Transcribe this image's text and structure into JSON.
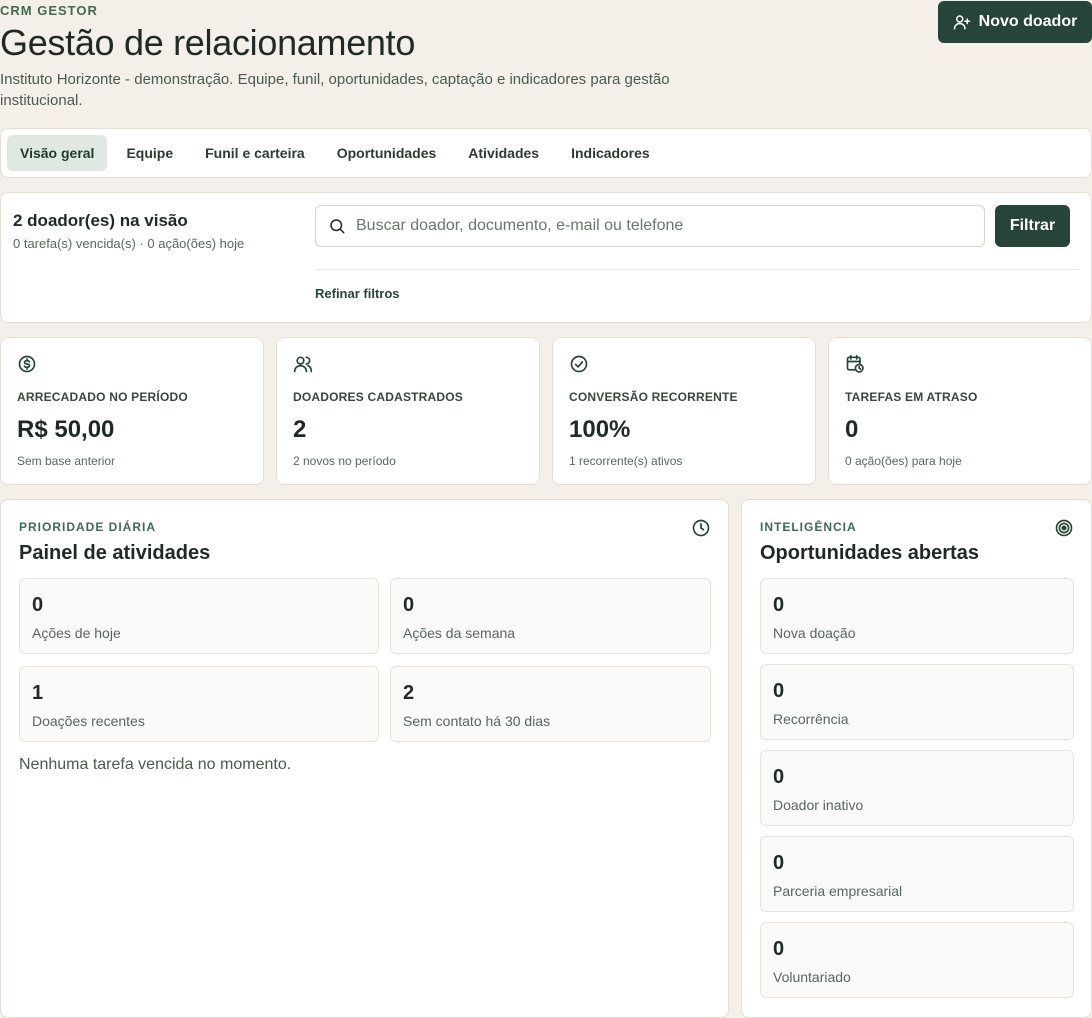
{
  "header": {
    "eyebrow": "CRM GESTOR",
    "title": "Gestão de relacionamento",
    "subtitle": "Instituto Horizonte - demonstração. Equipe, funil, oportunidades, captação e indicadores para gestão institucional.",
    "new_donor_label": "Novo doador"
  },
  "tabs": [
    {
      "label": "Visão geral",
      "active": true
    },
    {
      "label": "Equipe"
    },
    {
      "label": "Funil e carteira"
    },
    {
      "label": "Oportunidades"
    },
    {
      "label": "Atividades"
    },
    {
      "label": "Indicadores"
    }
  ],
  "filter": {
    "donor_count": "2 doador(es) na visão",
    "meta": "0 tarefa(s) vencida(s) · 0 ação(ões) hoje",
    "search_placeholder": "Buscar doador, documento, e-mail ou telefone",
    "filter_label": "Filtrar",
    "refine_label": "Refinar filtros"
  },
  "kpis": [
    {
      "icon": "dollar-circle-icon",
      "label": "ARRECADADO NO PERÍODO",
      "value": "R$ 50,00",
      "note": "Sem base anterior"
    },
    {
      "icon": "users-icon",
      "label": "DOADORES CADASTRADOS",
      "value": "2",
      "note": "2 novos no período"
    },
    {
      "icon": "check-circle-icon",
      "label": "CONVERSÃO RECORRENTE",
      "value": "100%",
      "note": "1 recorrente(s) ativos"
    },
    {
      "icon": "calendar-clock-icon",
      "label": "TAREFAS EM ATRASO",
      "value": "0",
      "note": "0 ação(ões) para hoje"
    }
  ],
  "activities": {
    "eyebrow": "PRIORIDADE DIÁRIA",
    "title": "Painel de atividades",
    "icon": "clock-icon",
    "stats": [
      {
        "value": "0",
        "label": "Ações de hoje"
      },
      {
        "value": "0",
        "label": "Ações da semana"
      },
      {
        "value": "1",
        "label": "Doações recentes"
      },
      {
        "value": "2",
        "label": "Sem contato há 30 dias"
      }
    ],
    "empty_message": "Nenhuma tarefa vencida no momento."
  },
  "opportunities": {
    "eyebrow": "INTELIGÊNCIA",
    "title": "Oportunidades abertas",
    "icon": "target-icon",
    "items": [
      {
        "value": "0",
        "label": "Nova doação"
      },
      {
        "value": "0",
        "label": "Recorrência"
      },
      {
        "value": "0",
        "label": "Doador inativo"
      },
      {
        "value": "0",
        "label": "Parceria empresarial"
      },
      {
        "value": "0",
        "label": "Voluntariado"
      }
    ]
  },
  "colors": {
    "background": "#f4efe8",
    "primary": "#264538",
    "accent": "#3e6a55",
    "active_tab": "#dfe9e2"
  }
}
